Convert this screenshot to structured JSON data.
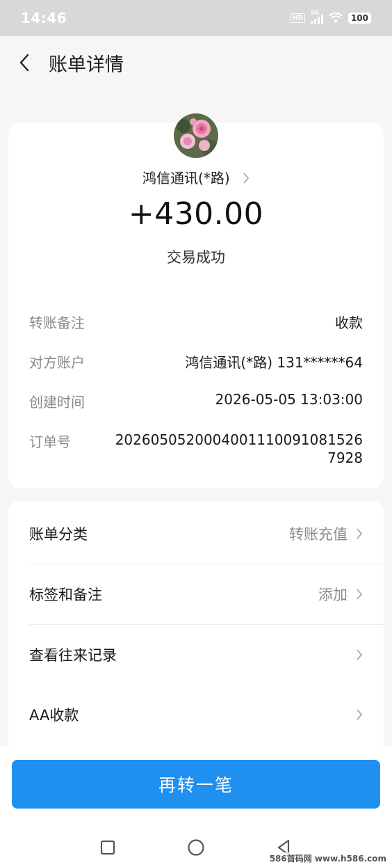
{
  "status_bar": {
    "time": "14:46",
    "hd": "HD",
    "network": "5G",
    "battery": "100"
  },
  "header": {
    "title": "账单详情",
    "back_icon": "chevron-left-icon"
  },
  "summary": {
    "payee": "鸿信通讯(*路)",
    "amount": "+430.00",
    "status": "交易成功"
  },
  "details": [
    {
      "label": "转账备注",
      "value": "收款"
    },
    {
      "label": "对方账户",
      "value": "鸿信通讯(*路) 131******64"
    },
    {
      "label": "创建时间",
      "value": "2026-05-05 13:03:00"
    },
    {
      "label": "订单号",
      "value": "20260505200040011100910815267928"
    }
  ],
  "menu": [
    {
      "label": "账单分类",
      "value": "转账充值"
    },
    {
      "label": "标签和备注",
      "value": "添加"
    },
    {
      "label": "查看往来记录",
      "value": ""
    },
    {
      "label": "AA收款",
      "value": ""
    }
  ],
  "action": {
    "primary_button": "再转一笔"
  },
  "watermark": "586首码网 www.h586.com",
  "colors": {
    "primary": "#1f8ff0",
    "background": "#f6f6f6",
    "card": "#ffffff",
    "muted_text": "#8a8a8a"
  }
}
